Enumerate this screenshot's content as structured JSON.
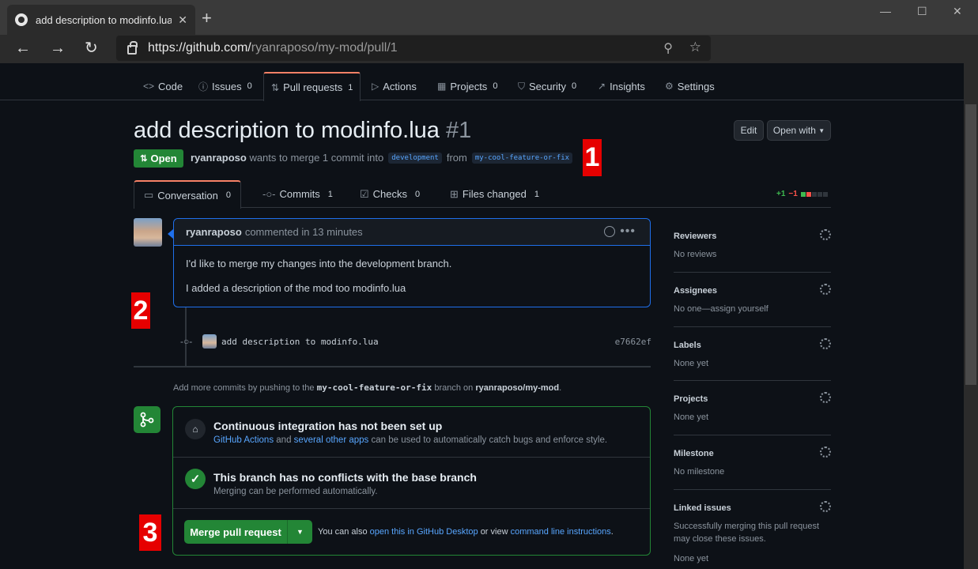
{
  "browser": {
    "tab_title": "add description to modinfo.lua b",
    "url_host": "https://github.com/",
    "url_path": "ryanraposo/my-mod/pull/1"
  },
  "repo_nav": {
    "tabs": [
      {
        "label": "Code",
        "count": ""
      },
      {
        "label": "Issues",
        "count": "0"
      },
      {
        "label": "Pull requests",
        "count": "1"
      },
      {
        "label": "Actions",
        "count": ""
      },
      {
        "label": "Projects",
        "count": "0"
      },
      {
        "label": "Security",
        "count": "0"
      },
      {
        "label": "Insights",
        "count": ""
      },
      {
        "label": "Settings",
        "count": ""
      }
    ]
  },
  "pr": {
    "title": "add description to modinfo.lua",
    "number": "#1",
    "state": "Open",
    "author": "ryanraposo",
    "merge_text": "wants to merge 1 commit into",
    "base_branch": "development",
    "from_text": "from",
    "head_branch": "my-cool-feature-or-fix",
    "edit_label": "Edit",
    "open_with_label": "Open with"
  },
  "annotations": {
    "one": "1",
    "two": "2",
    "three": "3"
  },
  "pr_tabs": [
    {
      "label": "Conversation",
      "count": "0"
    },
    {
      "label": "Commits",
      "count": "1"
    },
    {
      "label": "Checks",
      "count": "0"
    },
    {
      "label": "Files changed",
      "count": "1"
    }
  ],
  "diffstat": {
    "additions": "+1",
    "deletions": "−1"
  },
  "comment": {
    "author": "ryanraposo",
    "meta": "commented in 13 minutes",
    "body": [
      "I'd like to merge my changes into the development branch.",
      "I added a description of the mod too modinfo.lua"
    ]
  },
  "commit": {
    "message": "add description to modinfo.lua",
    "sha": "e7662ef"
  },
  "push_note": {
    "prefix": "Add more commits by pushing to the",
    "branch": "my-cool-feature-or-fix",
    "middle": "branch on",
    "repo": "ryanraposo/my-mod",
    "suffix": "."
  },
  "merge_box": {
    "ci_title": "Continuous integration has not been set up",
    "ci_link1": "GitHub Actions",
    "ci_and": "and",
    "ci_link2": "several other apps",
    "ci_rest": "can be used to automatically catch bugs and enforce style.",
    "conflict_title": "This branch has no conflicts with the base branch",
    "conflict_sub": "Merging can be performed automatically.",
    "merge_button": "Merge pull request",
    "also_prefix": "You can also",
    "also_link1": "open this in GitHub Desktop",
    "also_mid": "or view",
    "also_link2": "command line instructions",
    "also_suffix": "."
  },
  "sidebar": [
    {
      "heading": "Reviewers",
      "value": "No reviews"
    },
    {
      "heading": "Assignees",
      "value": "No one—assign yourself"
    },
    {
      "heading": "Labels",
      "value": "None yet"
    },
    {
      "heading": "Projects",
      "value": "None yet"
    },
    {
      "heading": "Milestone",
      "value": "No milestone"
    },
    {
      "heading": "Linked issues",
      "value": "Successfully merging this pull request may close these issues."
    },
    {
      "heading": "",
      "value": "None yet"
    }
  ],
  "colors": {
    "accent_green": "#238636",
    "link": "#58a6ff",
    "marker_red": "#e60000",
    "tab_underline": "#f78166"
  },
  "icons": [
    "github-favicon",
    "close-icon",
    "plus-icon",
    "back-arrow-icon",
    "forward-arrow-icon",
    "reload-icon",
    "lock-icon",
    "zoom-icon",
    "star-icon",
    "code-icon",
    "issue-icon",
    "pull-request-icon",
    "play-icon",
    "project-icon",
    "shield-icon",
    "graph-icon",
    "gear-icon",
    "copy-icon",
    "comment-icon",
    "commit-icon",
    "checklist-icon",
    "file-diff-icon",
    "smiley-icon",
    "kebab-icon",
    "merge-icon",
    "check-icon"
  ]
}
